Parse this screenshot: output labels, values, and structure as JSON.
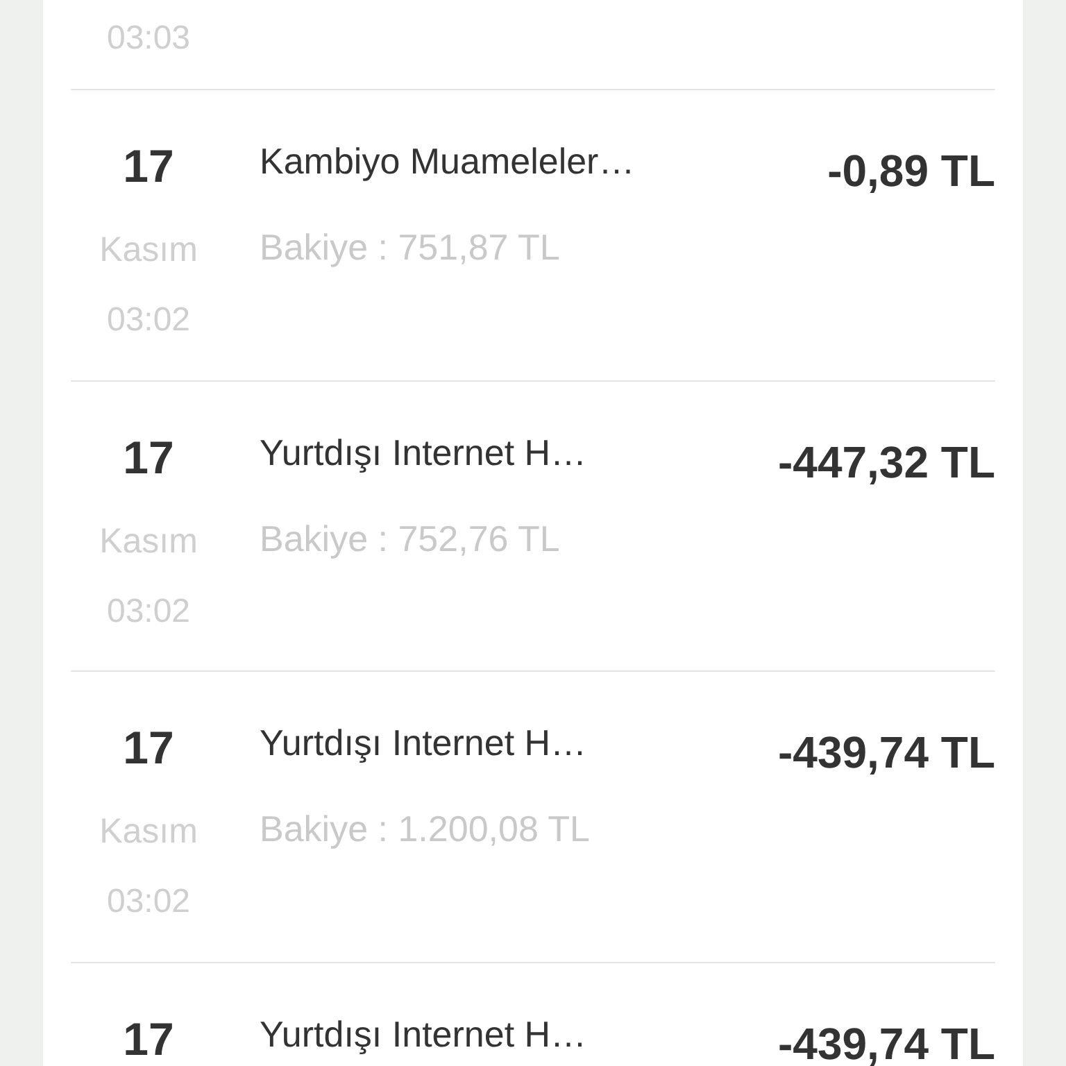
{
  "transactions": [
    {
      "time": "03:03"
    },
    {
      "day": "17",
      "month": "Kasım",
      "time": "03:02",
      "title": "Kambiyo Muameleler…",
      "balance": "Bakiye : 751,87 TL",
      "amount": "-0,89 TL"
    },
    {
      "day": "17",
      "month": "Kasım",
      "time": "03:02",
      "title": "Yurtdışı Internet H…",
      "balance": "Bakiye : 752,76 TL",
      "amount": "-447,32 TL"
    },
    {
      "day": "17",
      "month": "Kasım",
      "time": "03:02",
      "title": "Yurtdışı Internet H…",
      "balance": "Bakiye : 1.200,08 TL",
      "amount": "-439,74 TL"
    },
    {
      "day": "17",
      "title": "Yurtdışı Internet H…",
      "amount": "-439,74 TL"
    }
  ]
}
